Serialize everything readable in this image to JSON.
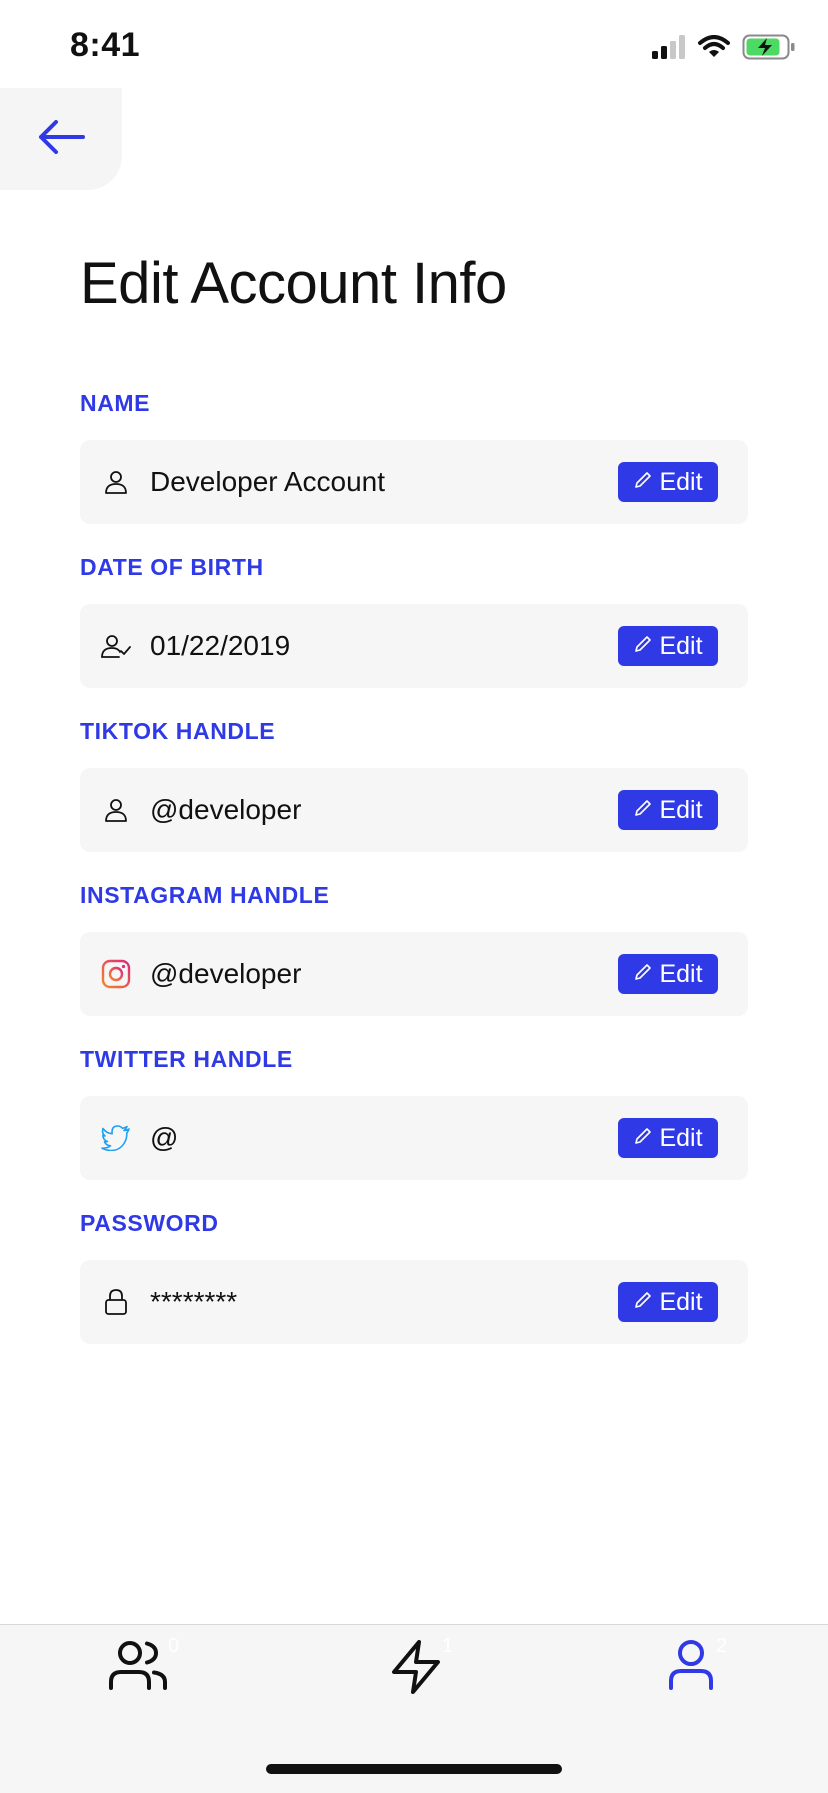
{
  "status_bar": {
    "time": "8:41",
    "icons": [
      "cellular-signal-icon",
      "wifi-icon",
      "battery-charging-icon"
    ]
  },
  "header": {
    "back_icon": "arrow-left-icon",
    "title": "Edit Account Info"
  },
  "fields": [
    {
      "label": "NAME",
      "value": "Developer Account",
      "icon": "user-icon",
      "edit_label": "Edit"
    },
    {
      "label": "DATE OF BIRTH",
      "value": "01/22/2019",
      "icon": "user-check-icon",
      "edit_label": "Edit"
    },
    {
      "label": "TIKTOK HANDLE",
      "value": "@developer",
      "icon": "user-icon",
      "edit_label": "Edit"
    },
    {
      "label": "INSTAGRAM HANDLE",
      "value": "@developer",
      "icon": "instagram-icon",
      "edit_label": "Edit"
    },
    {
      "label": "TWITTER HANDLE",
      "value": "@",
      "icon": "twitter-icon",
      "edit_label": "Edit"
    },
    {
      "label": "PASSWORD",
      "value": "********",
      "icon": "lock-icon",
      "edit_label": "Edit"
    }
  ],
  "tab_bar": {
    "tabs": [
      {
        "icon": "users-icon",
        "badge": "0",
        "active": false
      },
      {
        "icon": "lightning-icon",
        "badge": "1",
        "active": false
      },
      {
        "icon": "profile-icon",
        "badge": "2",
        "active": true
      }
    ]
  },
  "colors": {
    "accent": "#2f3ae6",
    "field_background": "#f6f6f6",
    "text": "#111111",
    "battery": "#4cd964",
    "twitter": "#1da1f2",
    "instagram_start": "#f58529",
    "instagram_end": "#dd2a7b"
  }
}
